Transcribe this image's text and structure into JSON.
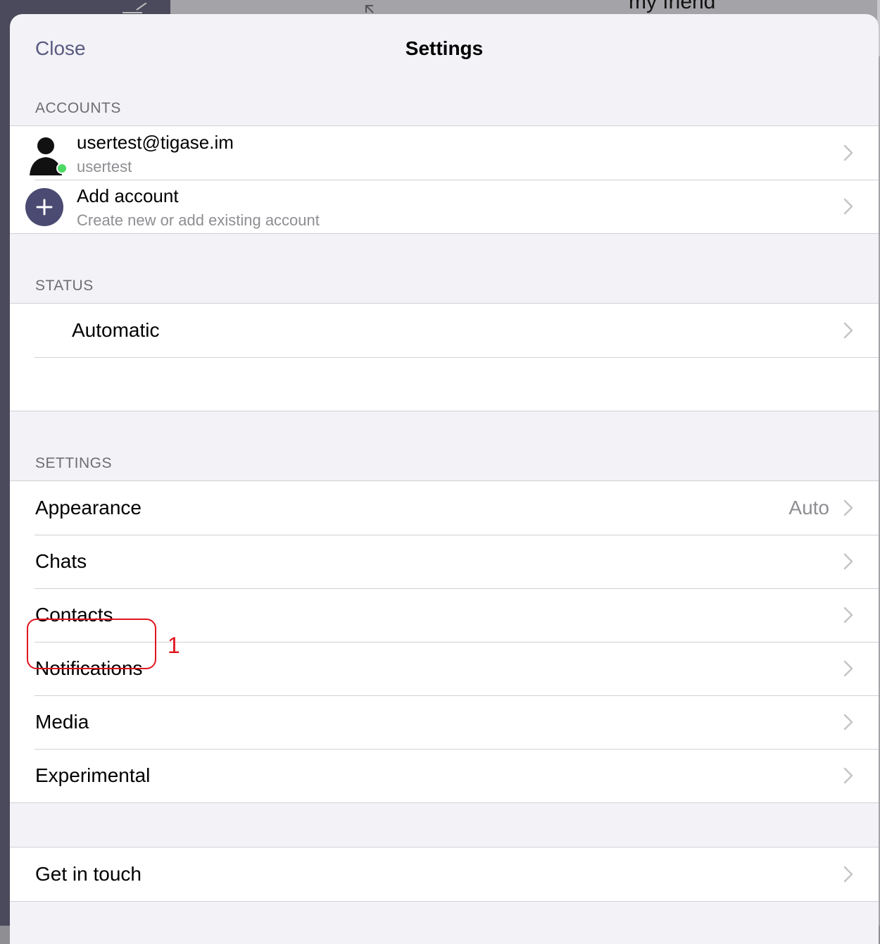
{
  "background": {
    "chat_title": "my friend"
  },
  "nav": {
    "close_label": "Close",
    "title": "Settings"
  },
  "accounts": {
    "header": "ACCOUNTS",
    "account": {
      "jid": "usertest@tigase.im",
      "name": "usertest",
      "status_color": "#4cd964"
    },
    "add": {
      "title": "Add account",
      "subtitle": "Create new or add existing account"
    }
  },
  "status": {
    "header": "STATUS",
    "value": "Automatic"
  },
  "settings": {
    "header": "SETTINGS",
    "items": [
      {
        "label": "Appearance",
        "value": "Auto"
      },
      {
        "label": "Chats"
      },
      {
        "label": "Contacts"
      },
      {
        "label": "Notifications"
      },
      {
        "label": "Media"
      },
      {
        "label": "Experimental"
      }
    ]
  },
  "footer": {
    "get_in_touch": "Get in touch"
  },
  "annotation": {
    "number": "1",
    "color": "#e0151f"
  }
}
